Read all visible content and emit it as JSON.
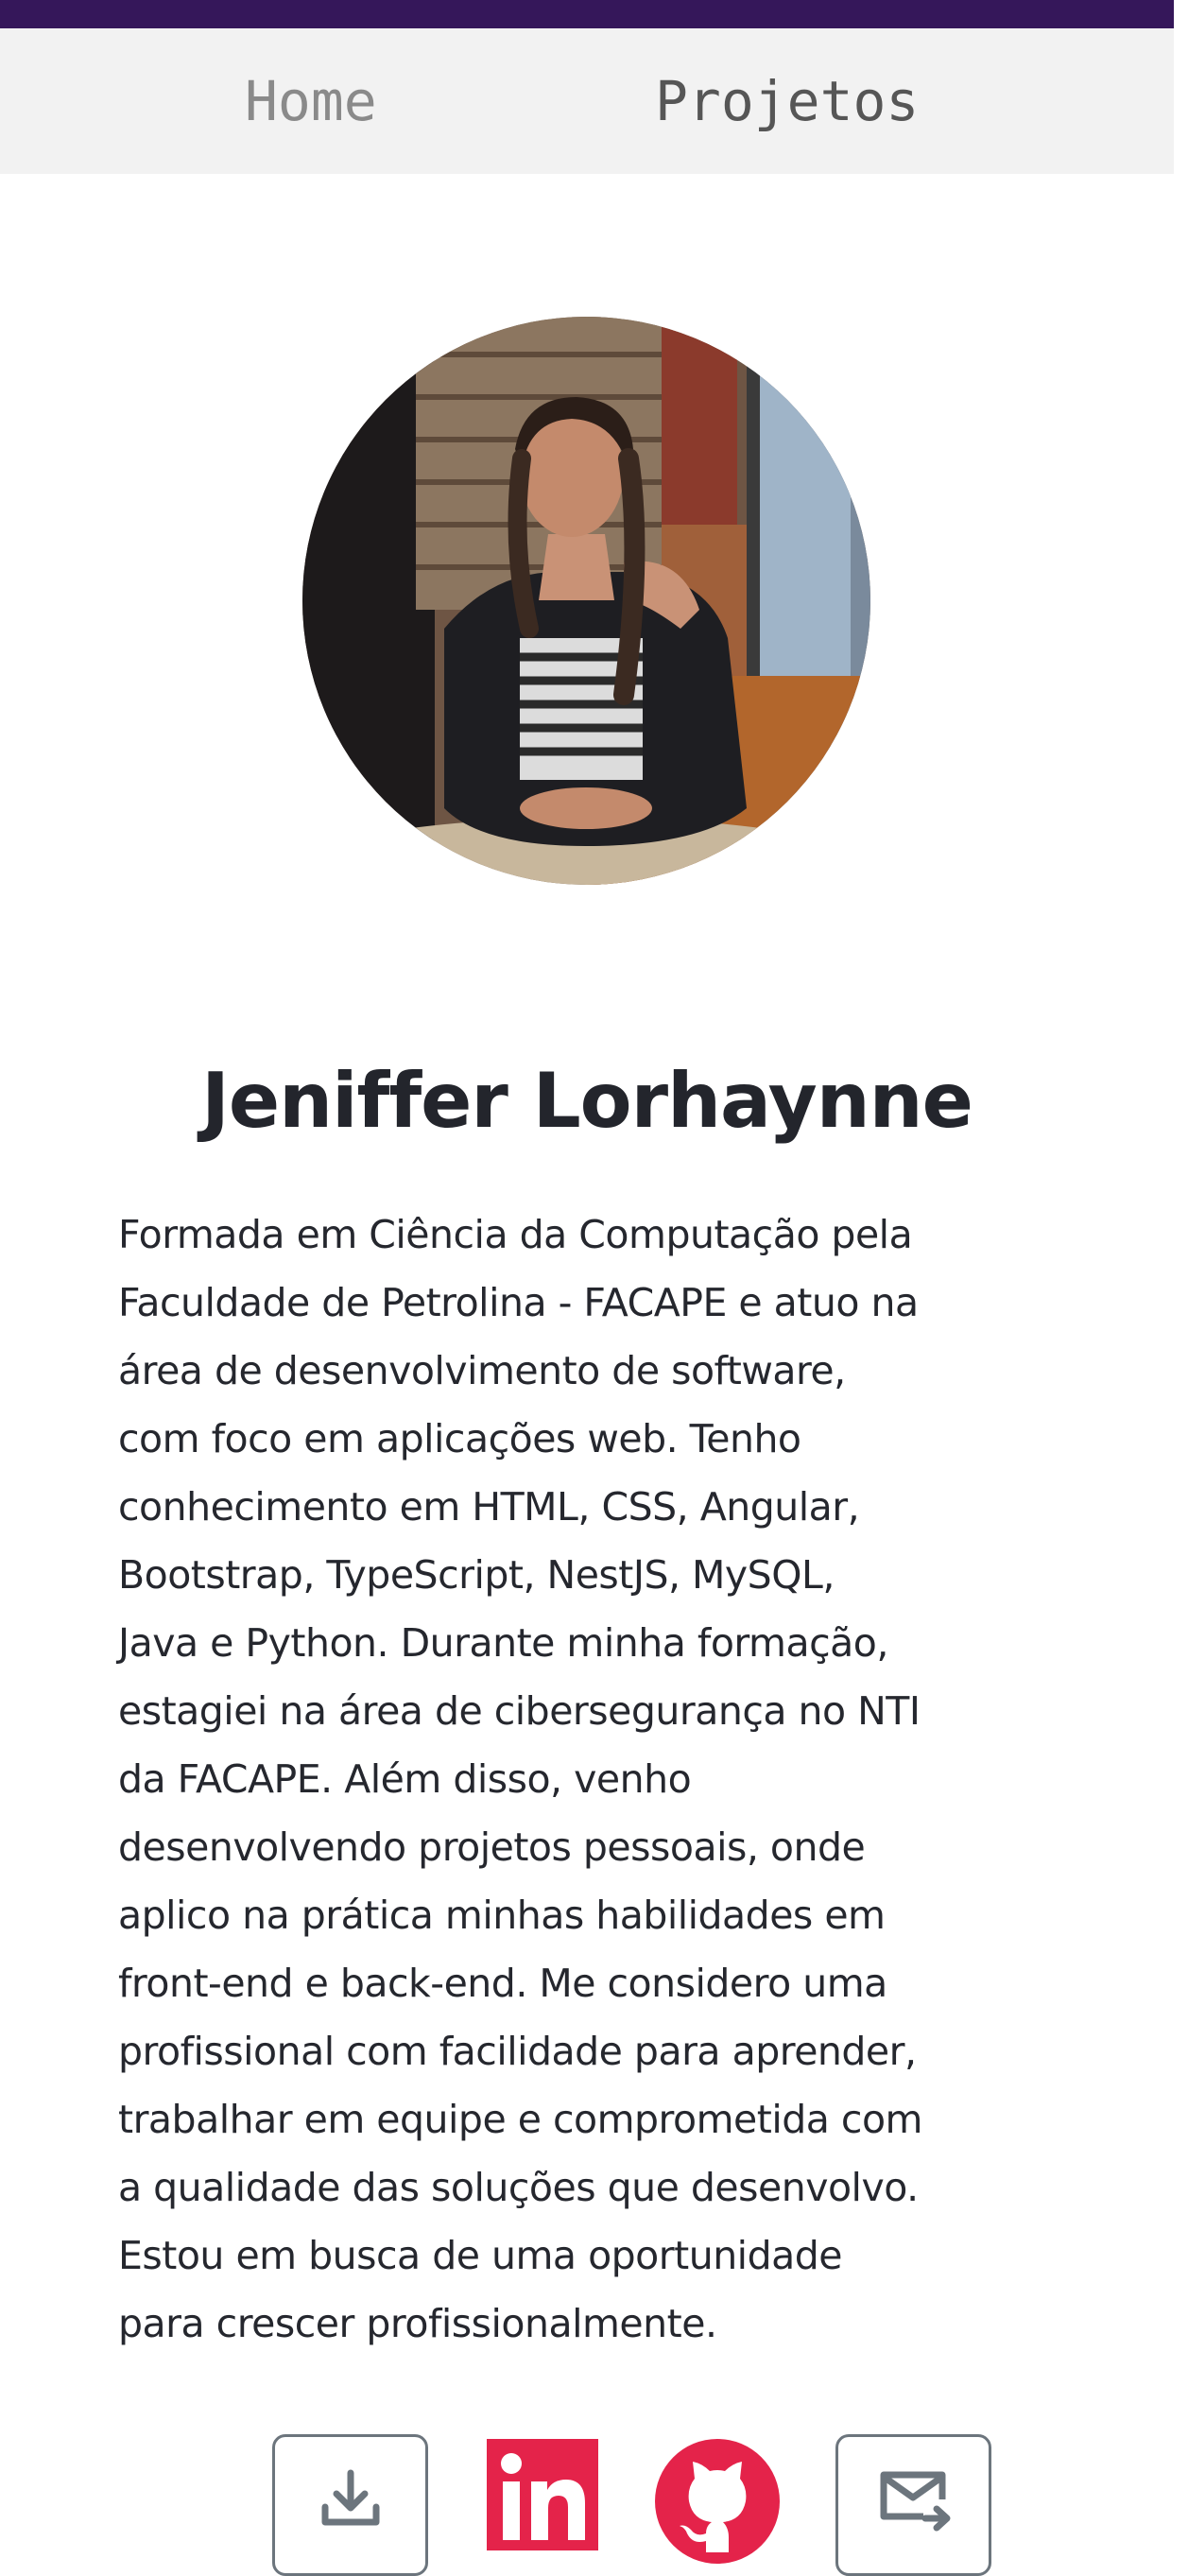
{
  "nav": {
    "home_label": "Home",
    "projects_label": "Projetos"
  },
  "profile": {
    "name": "Jeniffer Lorhaynne",
    "bio_lines": [
      "Formada em Ciência da Computação pela",
      "Faculdade de Petrolina - FACAPE e atuo na",
      "área de desenvolvimento de software,",
      "com foco em aplicações web. Tenho",
      "conhecimento em HTML, CSS, Angular,",
      "Bootstrap, TypeScript, NestJS, MySQL,",
      "Java e Python. Durante minha formação,",
      "estagiei na área de cibersegurança no NTI",
      "da FACAPE. Além disso, venho",
      "desenvolvendo projetos pessoais, onde",
      "aplico na prática minhas habilidades em",
      "front-end e back-end. Me considero uma",
      "profissional com facilidade para aprender,",
      "trabalhar em equipe e comprometida com",
      "a qualidade das soluções que desenvolvo.",
      "Estou em busca de uma oportunidade",
      "para crescer profissionalmente."
    ]
  },
  "actions": {
    "download_icon": "download-icon",
    "linkedin_icon": "linkedin-icon",
    "github_icon": "github-icon",
    "mail_icon": "mail-send-icon"
  },
  "colors": {
    "topbar": "#35175a",
    "nav_background": "#f2f2f2",
    "social_accent": "#e4234a",
    "outline_button": "#6c757d"
  }
}
